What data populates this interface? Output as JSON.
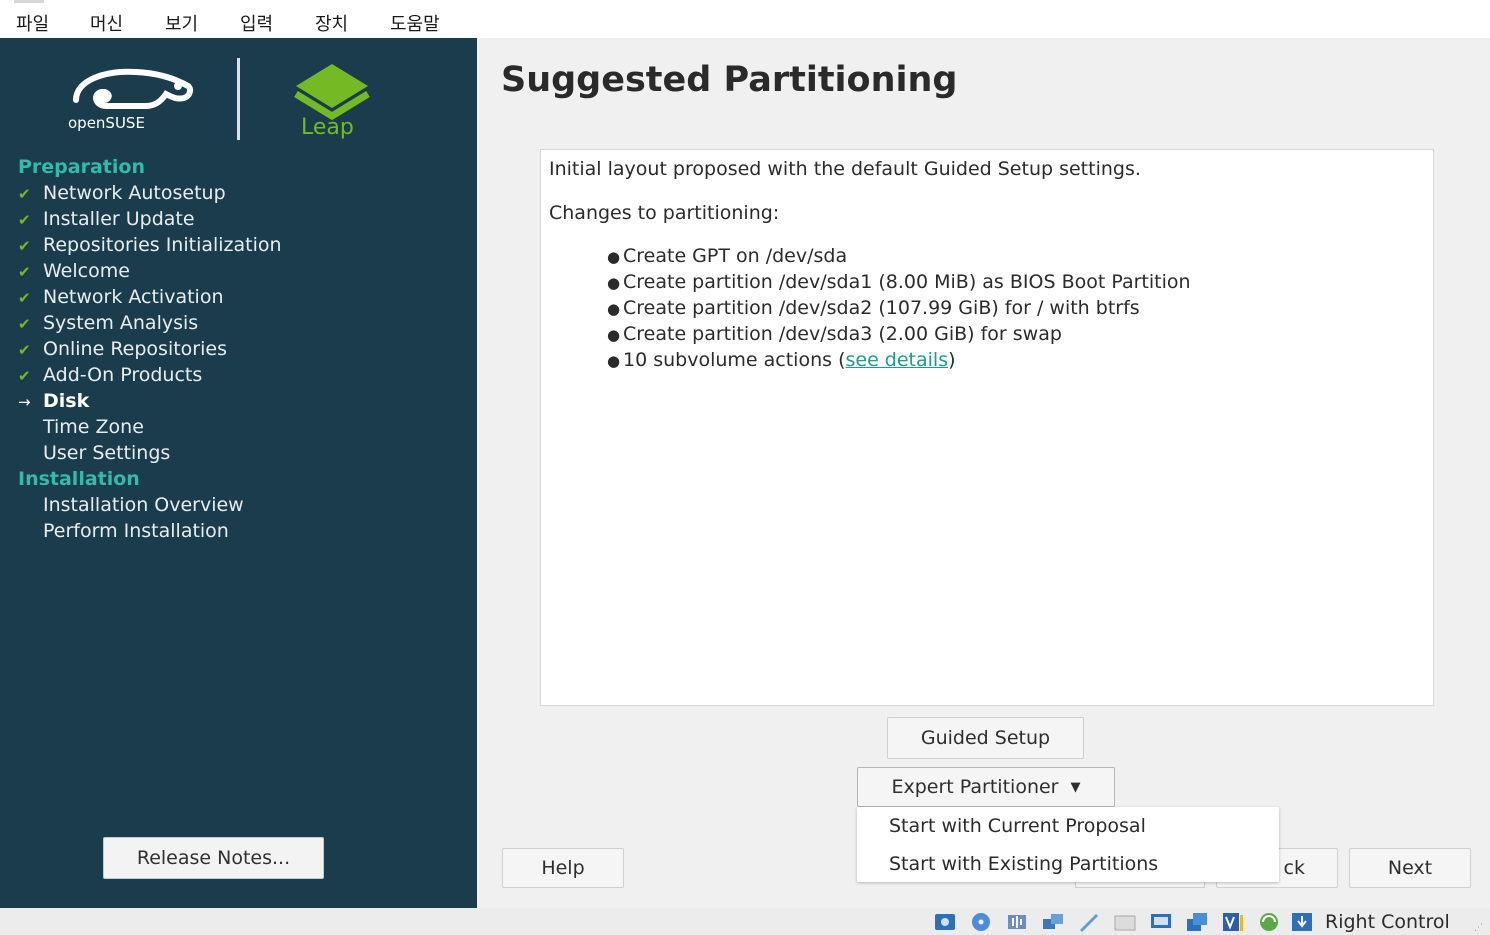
{
  "host_menu": [
    "파일",
    "머신",
    "보기",
    "입력",
    "장치",
    "도움말"
  ],
  "sidebar": {
    "logo_suse_text": "openSUSE",
    "logo_leap_text": "Leap",
    "sections": [
      {
        "title": "Preparation",
        "steps": [
          {
            "label": "Network Autosetup",
            "state": "done"
          },
          {
            "label": "Installer Update",
            "state": "done"
          },
          {
            "label": "Repositories Initialization",
            "state": "done"
          },
          {
            "label": "Welcome",
            "state": "done"
          },
          {
            "label": "Network Activation",
            "state": "done"
          },
          {
            "label": "System Analysis",
            "state": "done"
          },
          {
            "label": "Online Repositories",
            "state": "done"
          },
          {
            "label": "Add-On Products",
            "state": "done"
          },
          {
            "label": "Disk",
            "state": "current"
          },
          {
            "label": "Time Zone",
            "state": "pending"
          },
          {
            "label": "User Settings",
            "state": "pending"
          }
        ]
      },
      {
        "title": "Installation",
        "steps": [
          {
            "label": "Installation Overview",
            "state": "pending"
          },
          {
            "label": "Perform Installation",
            "state": "pending"
          }
        ]
      }
    ],
    "release_notes": "Release Notes..."
  },
  "main": {
    "title": "Suggested Partitioning",
    "intro": "Initial layout proposed with the default Guided Setup settings.",
    "changes_heading": "Changes to partitioning:",
    "changes": [
      "Create GPT on /dev/sda",
      "Create partition /dev/sda1 (8.00 MiB) as BIOS Boot Partition",
      "Create partition /dev/sda2 (107.99 GiB) for / with btrfs",
      "Create partition /dev/sda3 (2.00 GiB) for swap"
    ],
    "subvolume_prefix": "10 subvolume actions (",
    "subvolume_link": "see details",
    "subvolume_suffix": ")",
    "guided_setup": "Guided Setup",
    "expert_partitioner": "Expert Partitioner",
    "dropdown_options": [
      "Start with Current Proposal",
      "Start with Existing Partitions"
    ],
    "help": "Help",
    "back_visible": "ck",
    "next": "Next"
  },
  "statusbar": {
    "icons": [
      "hard-disk-icon",
      "optical-disk-icon",
      "audio-icon",
      "network-icon",
      "usb-icon",
      "shared-folder-icon",
      "display-icon",
      "screen-capture-icon",
      "recording-icon",
      "cpu-icon",
      "mouse-integration-icon",
      "keyboard-icon"
    ],
    "host_key": "Right Control"
  },
  "colors": {
    "sidebar_bg": "#1b3c4c",
    "section_accent": "#35b9ab",
    "check_green": "#73ba25",
    "link_teal": "#1e9a8e"
  }
}
